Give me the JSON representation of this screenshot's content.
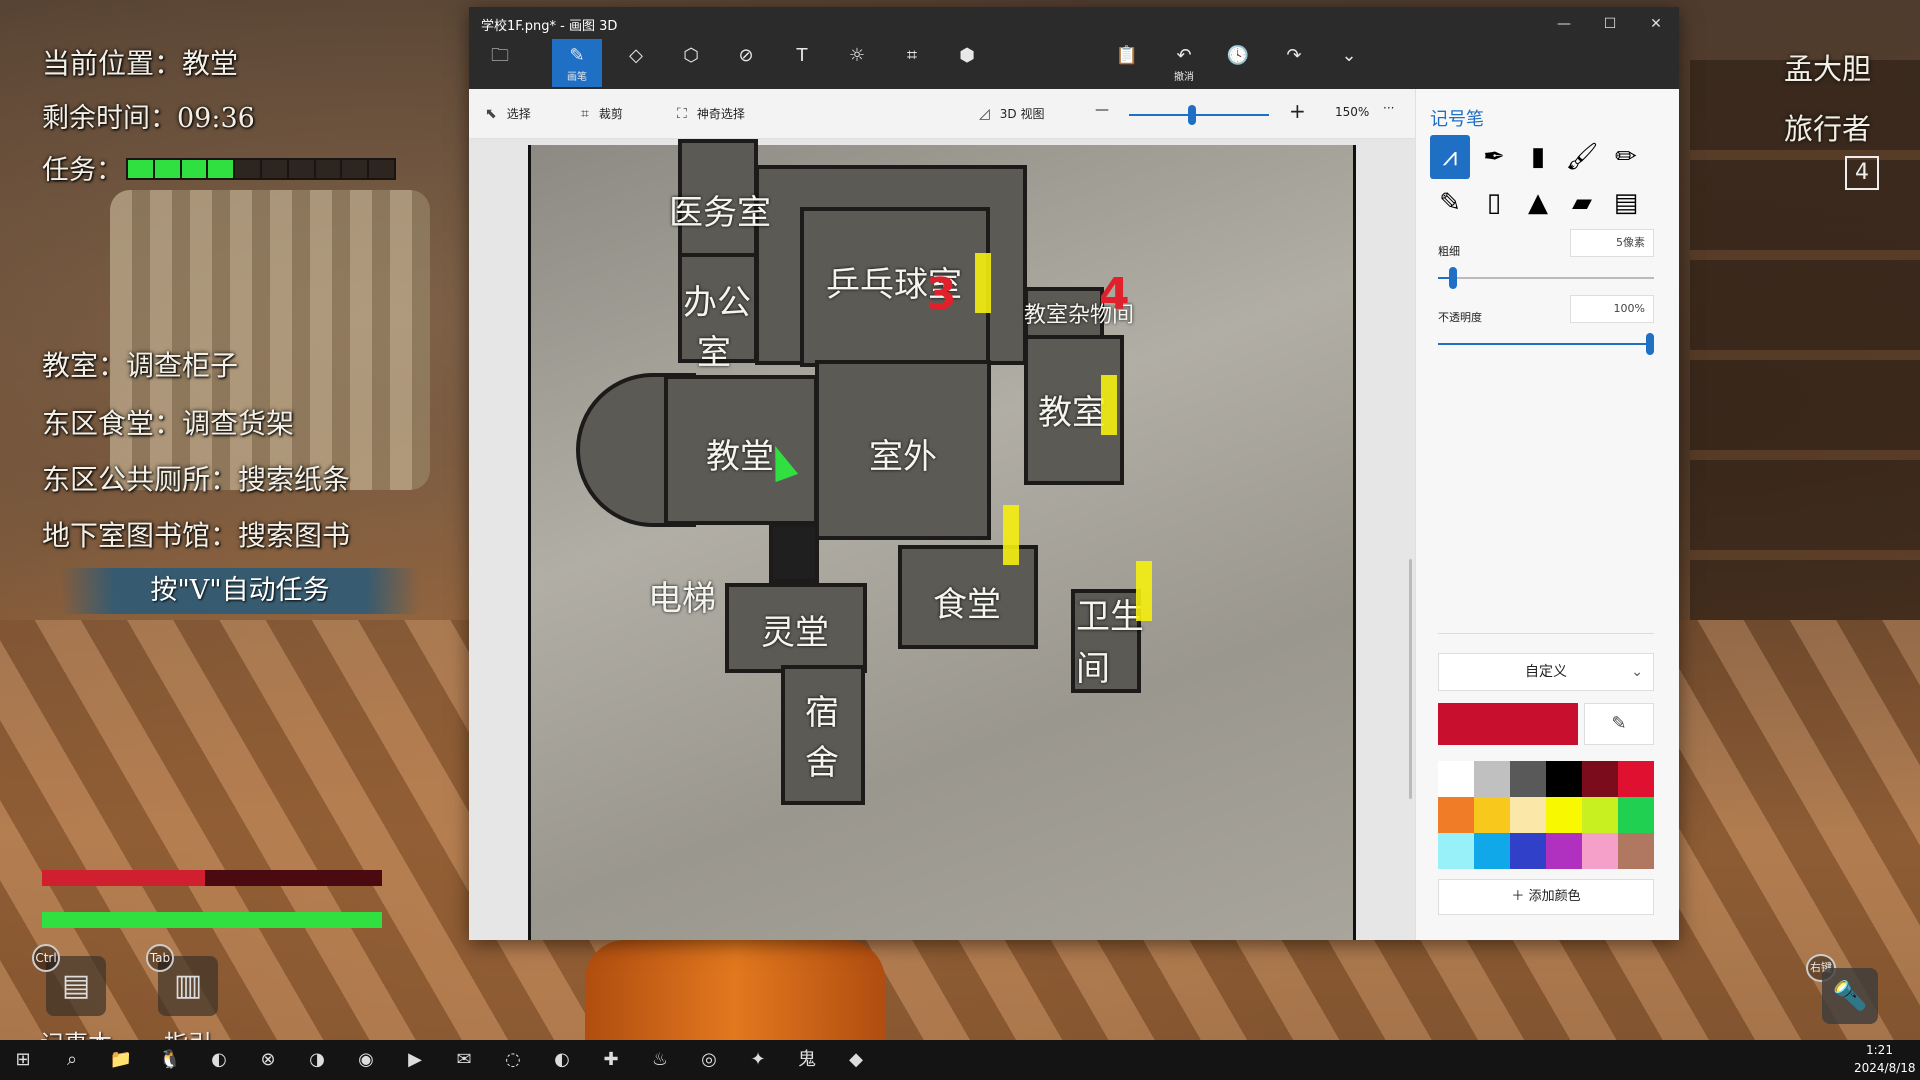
{
  "game": {
    "location": "当前位置：教堂",
    "time": "剩余时间：09:36",
    "task_label": "任务：",
    "task_progress_segments": {
      "filled": 4,
      "total": 10
    },
    "objectives": [
      "教室：调查柜子",
      "东区食堂：调查货架",
      "东区公共厕所：搜索纸条",
      "地下室图书馆：搜索图书"
    ],
    "auto_task": "按\"V\"自动任务",
    "health_fraction": 0.48,
    "stamina_fraction": 1.0,
    "hotkeys": [
      {
        "key": "Ctrl",
        "label": "记事本"
      },
      {
        "key": "Tab",
        "label": "指引"
      }
    ],
    "player_name": "孟大胆",
    "player_title": "旅行者",
    "player_level": "4",
    "flashlight_key": "右键"
  },
  "paint": {
    "window_title": "学校1F.png* - 画图 3D",
    "window_controls": [
      "—",
      "☐",
      "✕"
    ],
    "tools": [
      {
        "name": "menu",
        "icon": "🗀",
        "label": ""
      },
      {
        "name": "brushes",
        "icon": "✎",
        "label": "画笔"
      },
      {
        "name": "2d-shapes",
        "icon": "◇",
        "label": ""
      },
      {
        "name": "3d-shapes",
        "icon": "⬡",
        "label": ""
      },
      {
        "name": "stickers",
        "icon": "⊘",
        "label": ""
      },
      {
        "name": "text",
        "icon": "T",
        "label": ""
      },
      {
        "name": "effects",
        "icon": "☼",
        "label": ""
      },
      {
        "name": "canvas",
        "icon": "⌗",
        "label": ""
      },
      {
        "name": "3d-library",
        "icon": "⬢",
        "label": ""
      },
      {
        "name": "paste",
        "icon": "📋",
        "label": ""
      },
      {
        "name": "undo",
        "icon": "↶",
        "label": "撤消"
      },
      {
        "name": "history",
        "icon": "🕓",
        "label": ""
      },
      {
        "name": "redo",
        "icon": "↷",
        "label": ""
      },
      {
        "name": "expand",
        "icon": "⌄",
        "label": ""
      }
    ],
    "sub_toolbar": {
      "select": "选择",
      "crop": "裁剪",
      "magic_select": "神奇选择",
      "view_3d": "3D 视图",
      "zoom_out": "—",
      "zoom_in": "+",
      "zoom": "150%",
      "zoom_fraction": 0.45,
      "more": "···"
    },
    "map": {
      "rooms": [
        "医务室",
        "乒乓球室",
        "办公",
        "室",
        "教室杂物间",
        "教室",
        "教堂",
        "室外",
        "电梯",
        "灵堂",
        "食堂",
        "卫生",
        "间",
        "宿",
        "舍"
      ],
      "annotations": [
        "3",
        "4"
      ]
    },
    "panel": {
      "title": "记号笔",
      "brushes": [
        "marker",
        "calligraphy-pen",
        "oil-brush",
        "watercolor",
        "pixel-pen",
        "pencil",
        "eraser",
        "crayon",
        "spray-can",
        "fill"
      ],
      "thickness_label": "粗细",
      "thickness_value": "5像素",
      "thickness_fraction": 0.05,
      "opacity_label": "不透明度",
      "opacity_value": "100%",
      "opacity_fraction": 1.0,
      "preset": "自定义",
      "current_color": "#c8102e",
      "palette": [
        "#ffffff",
        "#c0c0c0",
        "#595959",
        "#000000",
        "#7a0c1c",
        "#e01030",
        "#f07c28",
        "#f8c81c",
        "#fbe8a8",
        "#f8f800",
        "#c8f020",
        "#20d050",
        "#98f0f8",
        "#10a8e8",
        "#3040c8",
        "#b030c0",
        "#f4a0c8",
        "#b07860"
      ],
      "add_color": "添加颜色"
    }
  },
  "taskbar": {
    "time": "1:21",
    "date": "2024/8/18",
    "icons": [
      "⊞",
      "⌕",
      "📁",
      "🐧",
      "◐",
      "⊗",
      "◑",
      "◉",
      "▶",
      "✉",
      "◌",
      "◐",
      "✚",
      "♨",
      "◎",
      "✦",
      "鬼",
      "◆"
    ]
  }
}
